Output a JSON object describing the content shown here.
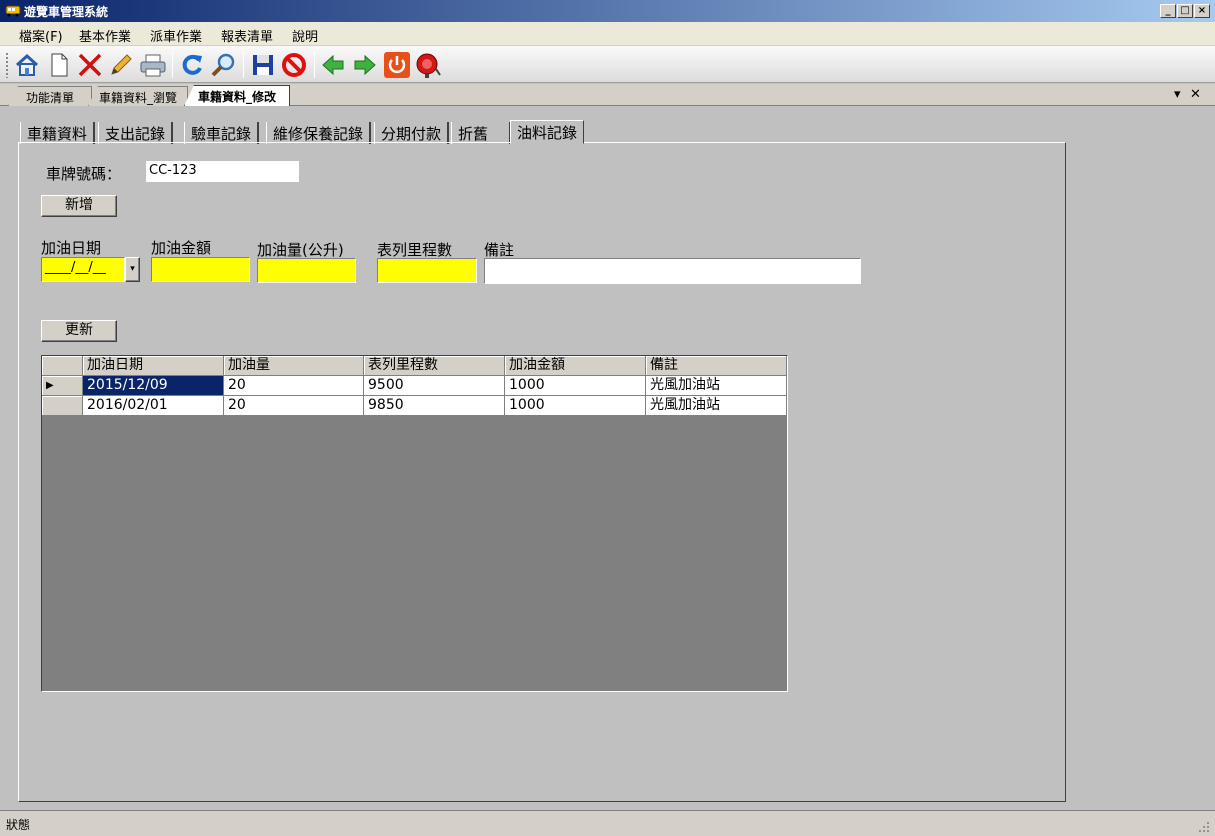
{
  "window": {
    "title": "遊覽車管理系統",
    "icon": "bus-icon"
  },
  "menu": [
    "檔案(F)",
    "基本作業",
    "派車作業",
    "報表清單",
    "說明"
  ],
  "toolbar": {
    "icons": [
      "home-icon",
      "new-document-icon",
      "delete-x-icon",
      "edit-pencil-icon",
      "print-icon",
      "refresh-icon",
      "search-magnifier-icon",
      "save-disk-icon",
      "stop-icon",
      "back-arrow-icon",
      "forward-arrow-icon",
      "power-icon",
      "alarm-bell-icon"
    ]
  },
  "doc_tabs": [
    "功能清單",
    "車籍資料_瀏覽",
    "車籍資料_修改"
  ],
  "doc_tab_active": 2,
  "tabs": [
    "車籍資料",
    "支出記錄",
    "驗車記錄",
    "維修保養記錄",
    "分期付款",
    "折舊",
    "油料記錄"
  ],
  "tab_active": 6,
  "form": {
    "plate_label": "車牌號碼：",
    "plate_value": "CC-123",
    "add_button": "新增",
    "fields": {
      "date_label": "加油日期",
      "date_value": "____/__/__",
      "amount_label": "加油金額",
      "amount_value": "",
      "volume_label": "加油量(公升)",
      "volume_value": "",
      "mileage_label": "表列里程數",
      "mileage_value": "",
      "note_label": "備註",
      "note_value": ""
    },
    "update_button": "更新"
  },
  "grid": {
    "columns": [
      "加油日期",
      "加油量",
      "表列里程數",
      "加油金額",
      "備註"
    ],
    "rows": [
      [
        "2015/12/09",
        "20",
        "9500",
        "1000",
        "光風加油站"
      ],
      [
        "2016/02/01",
        "20",
        "9850",
        "1000",
        "光風加油站"
      ]
    ],
    "selected_row": 0
  },
  "status": {
    "text": "狀態"
  },
  "colors": {
    "title_bar": "#0a246a",
    "highlight_input": "#ffff00",
    "selection": "#0a246a",
    "grid_background": "#808080"
  }
}
